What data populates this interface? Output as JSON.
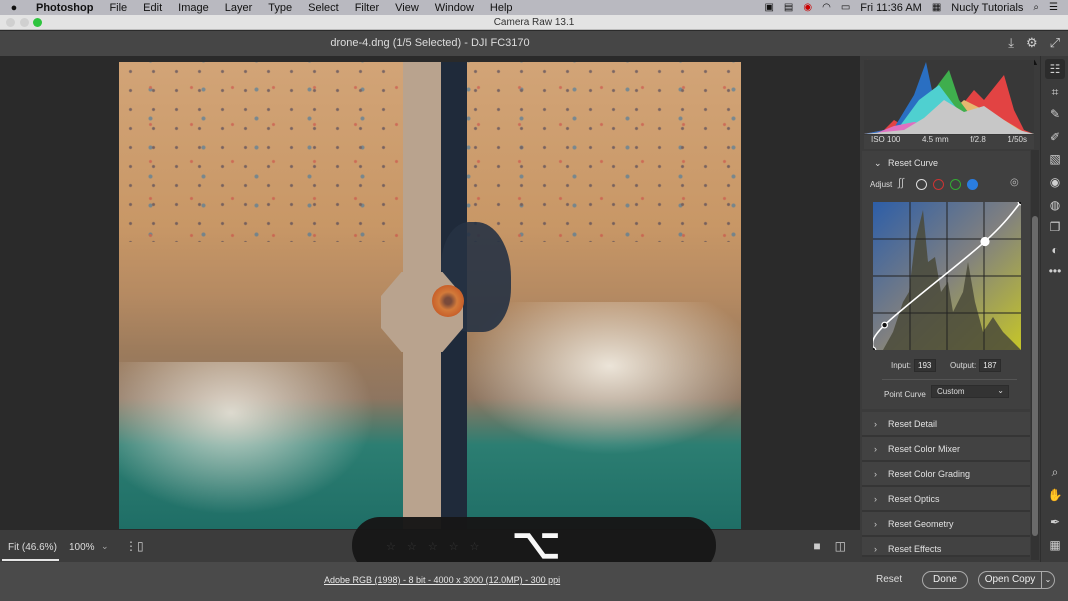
{
  "menubar": {
    "apple": "",
    "app": "Photoshop",
    "items": [
      "File",
      "Edit",
      "Image",
      "Layer",
      "Type",
      "Select",
      "Filter",
      "View",
      "Window",
      "Help"
    ],
    "status_icons": [
      "camera-record-icon",
      "display-icon",
      "creative-cloud-icon",
      "wifi-icon",
      "airplay-icon"
    ],
    "clock": "Fri 11:36 AM",
    "user": "Nucly Tutorials"
  },
  "window": {
    "title": "Camera Raw 13.1",
    "filename": "drone-4.dng (1/5 Selected)  -  DJI FC3170"
  },
  "histogram": {
    "exif": {
      "iso": "ISO 100",
      "focal": "4.5 mm",
      "aperture": "f/2.8",
      "shutter": "1/50s"
    }
  },
  "curve": {
    "section_title": "Reset Curve",
    "adjust_label": "Adjust",
    "channels": [
      "parametric",
      "rgb",
      "red",
      "green",
      "blue"
    ],
    "active_channel": "blue",
    "input_label": "Input:",
    "input_value": "193",
    "output_label": "Output:",
    "output_value": "187",
    "point_curve_label": "Point Curve",
    "point_curve_value": "Custom",
    "points": [
      [
        0,
        0
      ],
      [
        20,
        43
      ],
      [
        193,
        187
      ],
      [
        255,
        255
      ]
    ]
  },
  "sections": [
    "Reset Detail",
    "Reset Color Mixer",
    "Reset Color Grading",
    "Reset Optics",
    "Reset Geometry",
    "Reset Effects"
  ],
  "bottombar": {
    "zoom_fit": "Fit (46.6%)",
    "zoom_100": "100%",
    "rating_stars": "☆ ☆ ☆ ☆ ☆",
    "overlay_key": "⌥"
  },
  "footer": {
    "info": "Adobe RGB (1998) - 8 bit - 4000 x 3000 (12.0MP) - 300 ppi",
    "reset": "Reset",
    "done": "Done",
    "open_copy": "Open Copy"
  },
  "tools": [
    "edit",
    "crop",
    "healing",
    "brush",
    "linear-gradient",
    "radial-filter",
    "red-eye",
    "snapshots",
    "presets",
    "more",
    "zoom",
    "hand",
    "color-sampler",
    "grid"
  ]
}
